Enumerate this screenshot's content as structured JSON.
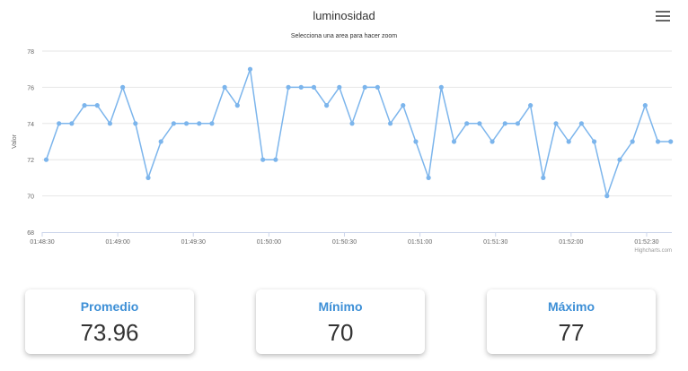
{
  "chart_data": {
    "type": "line",
    "title": "luminosidad",
    "subtitle": "Selecciona una area para hacer zoom",
    "ylabel": "Valor",
    "credits": "Highcharts.com",
    "ylim": [
      68,
      78
    ],
    "yticks": [
      68,
      70,
      72,
      74,
      76,
      78
    ],
    "xticks": [
      {
        "t": 0,
        "label": "01:48:30"
      },
      {
        "t": 30,
        "label": "01:49:00"
      },
      {
        "t": 60,
        "label": "01:49:30"
      },
      {
        "t": 90,
        "label": "01:50:00"
      },
      {
        "t": 120,
        "label": "01:50:30"
      },
      {
        "t": 150,
        "label": "01:51:00"
      },
      {
        "t": 180,
        "label": "01:51:30"
      },
      {
        "t": 210,
        "label": "01:52:00"
      },
      {
        "t": 240,
        "label": "01:52:30"
      }
    ],
    "xlim": [
      0,
      250
    ],
    "line_color": "#7cb5ec",
    "grid": true,
    "values": [
      72,
      74,
      74,
      75,
      75,
      74,
      76,
      74,
      71,
      73,
      74,
      74,
      74,
      74,
      76,
      75,
      77,
      72,
      72,
      76,
      76,
      76,
      75,
      76,
      74,
      76,
      76,
      74,
      75,
      73,
      71,
      76,
      73,
      74,
      74,
      73,
      74,
      74,
      75,
      71,
      74,
      73,
      74,
      73,
      70,
      72,
      73,
      75,
      73,
      73
    ],
    "x_start": 1.6,
    "x_step": 5.06
  },
  "stats": {
    "promedio_label": "Promedio",
    "promedio_value": "73.96",
    "minimo_label": "Mínimo",
    "minimo_value": "70",
    "maximo_label": "Máximo",
    "maximo_value": "77"
  },
  "colors": {
    "accent": "#3d8fd6",
    "series": "#7cb5ec"
  }
}
